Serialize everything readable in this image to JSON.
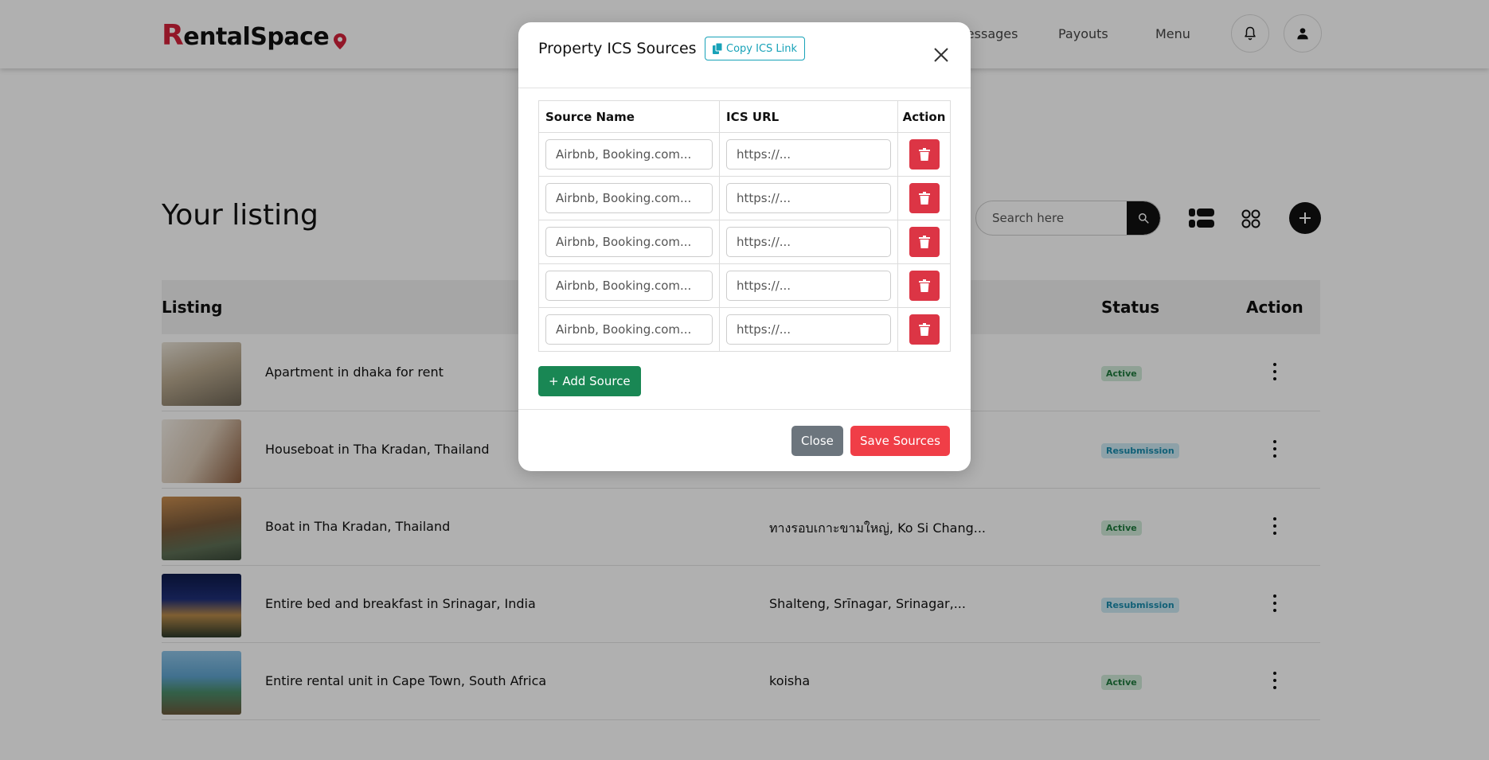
{
  "header": {
    "logo_initial": "R",
    "logo_text": "entalSpace",
    "nav": [
      "Messages",
      "Payouts",
      "Menu"
    ]
  },
  "page": {
    "title": "Your listing",
    "search_placeholder": "Search here",
    "columns": {
      "listing": "Listing",
      "status": "Status",
      "action": "Action"
    },
    "rows": [
      {
        "name": "Apartment in dhaka for rent",
        "location": "",
        "status": "Active"
      },
      {
        "name": "Houseboat in Tha Kradan, Thailand",
        "location": "",
        "status": "Resubmission"
      },
      {
        "name": "Boat in Tha Kradan, Thailand",
        "location": "ทางรอบเกาะขามใหญ่, Ko Si Chang...",
        "status": "Active"
      },
      {
        "name": "Entire bed and breakfast in Srinagar, India",
        "location": "Shalteng, Srīnagar, Srinagar,...",
        "status": "Resubmission"
      },
      {
        "name": "Entire rental unit in Cape Town, South Africa",
        "location": "koisha",
        "status": "Active"
      }
    ]
  },
  "modal": {
    "title": "Property ICS Sources",
    "copy_label": "Copy ICS Link",
    "columns": {
      "source_name": "Source Name",
      "ics_url": "ICS URL",
      "action": "Action"
    },
    "rows": [
      {
        "name_placeholder": "Airbnb, Booking.com...",
        "url_placeholder": "https://..."
      },
      {
        "name_placeholder": "Airbnb, Booking.com...",
        "url_placeholder": "https://..."
      },
      {
        "name_placeholder": "Airbnb, Booking.com...",
        "url_placeholder": "https://..."
      },
      {
        "name_placeholder": "Airbnb, Booking.com...",
        "url_placeholder": "https://..."
      },
      {
        "name_placeholder": "Airbnb, Booking.com...",
        "url_placeholder": "https://..."
      }
    ],
    "add_label": "+ Add Source",
    "close_label": "Close",
    "save_label": "Save Sources"
  },
  "colors": {
    "brand": "#d4223b",
    "danger": "#dc3545",
    "success": "#198754",
    "info": "#17a2b8",
    "save": "#f03e47"
  }
}
